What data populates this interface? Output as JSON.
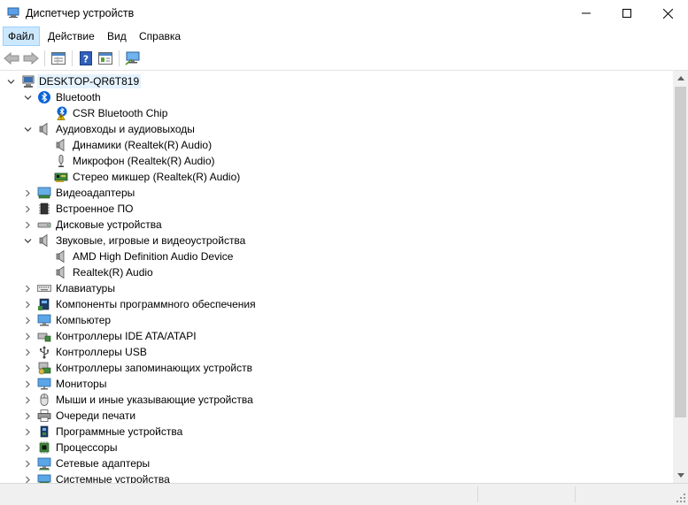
{
  "window": {
    "title": "Диспетчер устройств"
  },
  "menu": {
    "items": [
      "Файл",
      "Действие",
      "Вид",
      "Справка"
    ]
  },
  "toolbar": {
    "buttons": [
      "back-arrow-icon",
      "forward-arrow-icon",
      "properties-icon",
      "help-icon",
      "update-driver-icon",
      "scan-hardware-icon"
    ]
  },
  "tree": {
    "root": "DESKTOP-QR6T819",
    "rows": [
      {
        "label": "Bluetooth",
        "icon": "bluetooth-icon",
        "expanded": true
      },
      {
        "label": "CSR Bluetooth Chip",
        "icon": "warning-bluetooth-icon"
      },
      {
        "label": "Аудиовходы и аудиовыходы",
        "icon": "speaker-icon",
        "expanded": true
      },
      {
        "label": "Динамики (Realtek(R) Audio)",
        "icon": "speaker-icon"
      },
      {
        "label": "Микрофон (Realtek(R) Audio)",
        "icon": "microphone-icon"
      },
      {
        "label": "Стерео микшер (Realtek(R) Audio)",
        "icon": "sound-card-icon"
      },
      {
        "label": "Видеоадаптеры",
        "icon": "display-adapter-icon",
        "expanded": false
      },
      {
        "label": "Встроенное ПО",
        "icon": "firmware-chip-icon",
        "expanded": false
      },
      {
        "label": "Дисковые устройства",
        "icon": "disk-drive-icon",
        "expanded": false
      },
      {
        "label": "Звуковые, игровые и видеоустройства",
        "icon": "speaker-icon",
        "expanded": true
      },
      {
        "label": "AMD High Definition Audio Device",
        "icon": "speaker-icon"
      },
      {
        "label": "Realtek(R) Audio",
        "icon": "speaker-icon"
      },
      {
        "label": "Клавиатуры",
        "icon": "keyboard-icon",
        "expanded": false
      },
      {
        "label": "Компоненты программного обеспечения",
        "icon": "software-component-icon",
        "expanded": false
      },
      {
        "label": "Компьютер",
        "icon": "computer-icon",
        "expanded": false
      },
      {
        "label": "Контроллеры IDE ATA/ATAPI",
        "icon": "ide-controller-icon",
        "expanded": false
      },
      {
        "label": "Контроллеры USB",
        "icon": "usb-icon",
        "expanded": false
      },
      {
        "label": "Контроллеры запоминающих устройств",
        "icon": "storage-controller-icon",
        "expanded": false
      },
      {
        "label": "Мониторы",
        "icon": "monitor-icon",
        "expanded": false
      },
      {
        "label": "Мыши и иные указывающие устройства",
        "icon": "mouse-icon",
        "expanded": false
      },
      {
        "label": "Очереди печати",
        "icon": "printer-icon",
        "expanded": false
      },
      {
        "label": "Программные устройства",
        "icon": "software-device-icon",
        "expanded": false
      },
      {
        "label": "Процессоры",
        "icon": "processor-icon",
        "expanded": false
      },
      {
        "label": "Сетевые адаптеры",
        "icon": "network-adapter-icon",
        "expanded": false
      },
      {
        "label": "Системные устройства",
        "icon": "system-device-icon",
        "expanded": false
      }
    ]
  },
  "colors": {
    "selection": "#e5f3ff",
    "menu_active": "#cce8ff",
    "folder_blue": "#3a8ee6"
  }
}
